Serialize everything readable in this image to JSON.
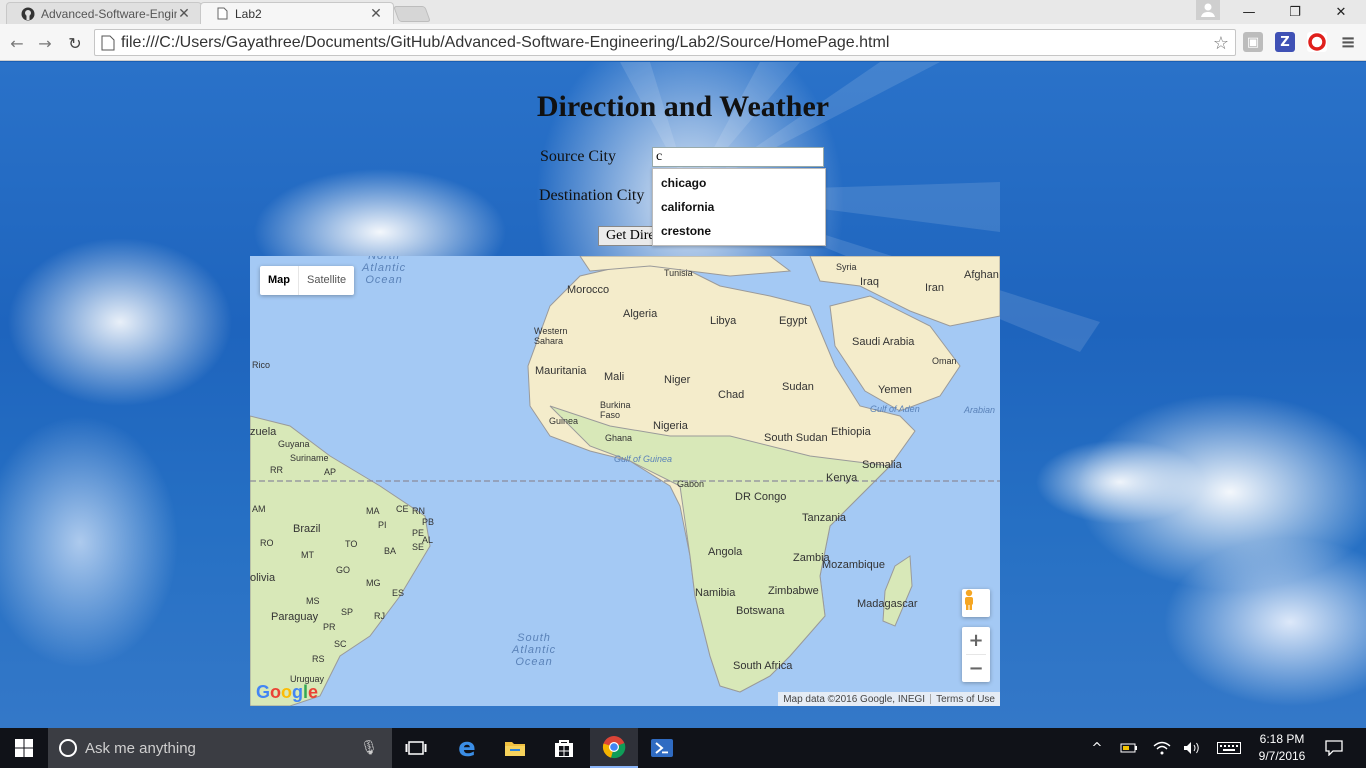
{
  "browser": {
    "tabs": [
      {
        "title": "Advanced-Software-Engin",
        "icon": "github-icon",
        "active": false
      },
      {
        "title": "Lab2",
        "icon": "page-icon",
        "active": true
      }
    ],
    "url": "file:///C:/Users/Gayathree/Documents/GitHub/Advanced-Software-Engineering/Lab2/Source/HomePage.html"
  },
  "page": {
    "title": "Direction and Weather",
    "source_label": "Source City",
    "destination_label": "Destination City",
    "source_value": "c",
    "button_label": "Get Dire",
    "suggestions": [
      "chicago",
      "california",
      "crestone"
    ]
  },
  "map": {
    "type_map": "Map",
    "type_satellite": "Satellite",
    "attribution": "Map data ©2016 Google, INEGI",
    "terms": "Terms of Use",
    "logo": "Google",
    "labels": {
      "north_atlantic": "North\nAtlantic\nOcean",
      "south_atlantic": "South\nAtlantic\nOcean",
      "gulf_guinea": "Gulf of Guinea",
      "gulf_aden": "Gulf of Aden",
      "arabian": "Arabian",
      "tunisia": "Tunisia",
      "syria": "Syria",
      "afghan": "Afghan",
      "morocco": "Morocco",
      "iraq": "Iraq",
      "iran": "Iran",
      "algeria": "Algeria",
      "libya": "Libya",
      "egypt": "Egypt",
      "western_sahara": "Western\nSahara",
      "saudi": "Saudi Arabia",
      "oman": "Oman",
      "rico": "Rico",
      "mauritania": "Mauritania",
      "mali": "Mali",
      "niger": "Niger",
      "sudan": "Sudan",
      "yemen": "Yemen",
      "chad": "Chad",
      "burkina": "Burkina\nFaso",
      "guinea": "Guinea",
      "nigeria": "Nigeria",
      "ghana": "Ghana",
      "south_sudan": "South Sudan",
      "ethiopia": "Ethiopia",
      "zuela": "zuela",
      "guyana": "Guyana",
      "suriname": "Suriname",
      "somalia": "Somalia",
      "rr": "RR",
      "ap": "AP",
      "kenya": "Kenya",
      "gabon": "Gabon",
      "dr_congo": "DR Congo",
      "am": "AM",
      "ma": "MA",
      "ce": "CE",
      "rn": "RN",
      "pb": "PB",
      "pi": "PI",
      "pe": "PE",
      "al": "AL",
      "brazil": "Brazil",
      "tanzania": "Tanzania",
      "ro": "RO",
      "to": "TO",
      "se": "SE",
      "ba": "BA",
      "mt": "MT",
      "angola": "Angola",
      "zambia": "Zambia",
      "mozambique": "Mozambique",
      "go": "GO",
      "olivia": "olivia",
      "mg": "MG",
      "es": "ES",
      "zimbabwe": "Zimbabwe",
      "namibia": "Namibia",
      "ms": "MS",
      "madagascar": "Madagascar",
      "botswana": "Botswana",
      "sp": "SP",
      "rj": "RJ",
      "paraguay": "Paraguay",
      "pr": "PR",
      "sc": "SC",
      "rs": "RS",
      "south_africa": "South Africa",
      "uruguay": "Uruguay"
    }
  },
  "taskbar": {
    "search_placeholder": "Ask me anything",
    "time": "6:18 PM",
    "date": "9/7/2016"
  },
  "colors": {
    "ocean": "#a4c9f4",
    "land_north": "#f4eccb",
    "land_south": "#d8e8b8",
    "taskbar": "#101218"
  }
}
